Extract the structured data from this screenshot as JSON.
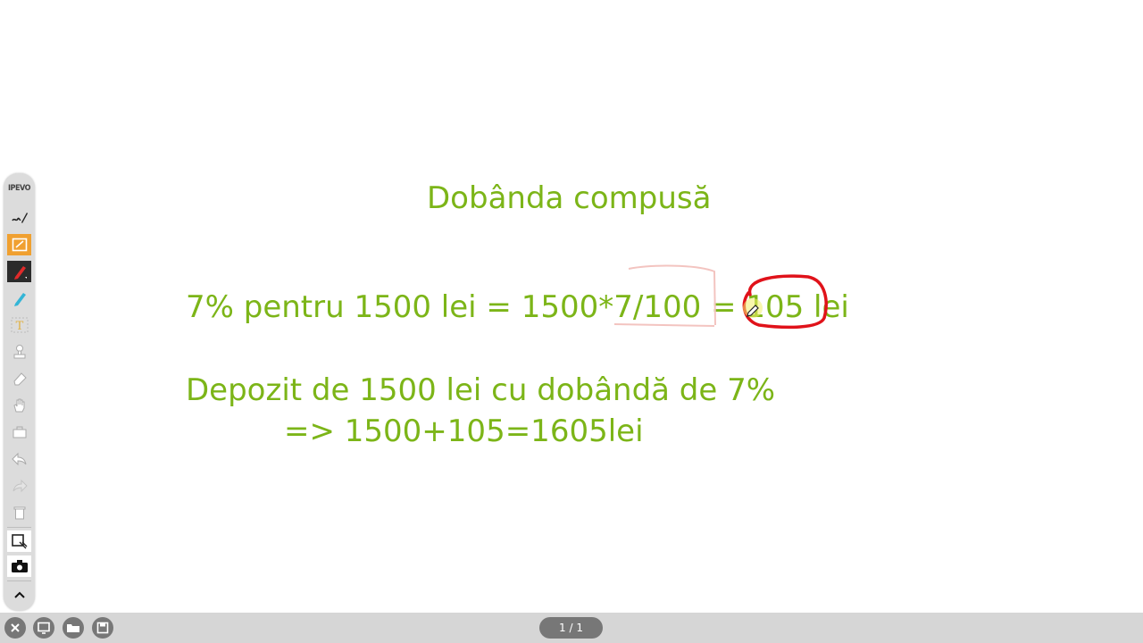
{
  "slide": {
    "title": "Dobânda compusă",
    "line1": "7% pentru 1500 lei = 1500*7/100 = 105 lei",
    "line2": "Depozit de 1500 lei cu dobândă de 7%",
    "line3": "=> 1500+105=1605lei"
  },
  "colors": {
    "text_green": "#7cb518",
    "ink_red": "#e0121a",
    "toolbar_bg": "#dcdcdc",
    "active_orange": "#f0a030"
  },
  "toolbar": {
    "logo": "IPEVO",
    "tools": [
      "annotation-mode-icon",
      "whiteboard-mode-icon",
      "pen-icon",
      "highlighter-icon",
      "text-icon",
      "stamp-icon",
      "eraser-icon",
      "hand-icon",
      "toolbox-icon",
      "undo-icon",
      "redo-icon",
      "trash-icon",
      "snapshot-icon",
      "camera-icon",
      "collapse-icon"
    ]
  },
  "bottombar": {
    "page_indicator": "1 / 1",
    "buttons": [
      "close-icon",
      "new-page-icon",
      "open-folder-icon",
      "save-icon"
    ]
  }
}
